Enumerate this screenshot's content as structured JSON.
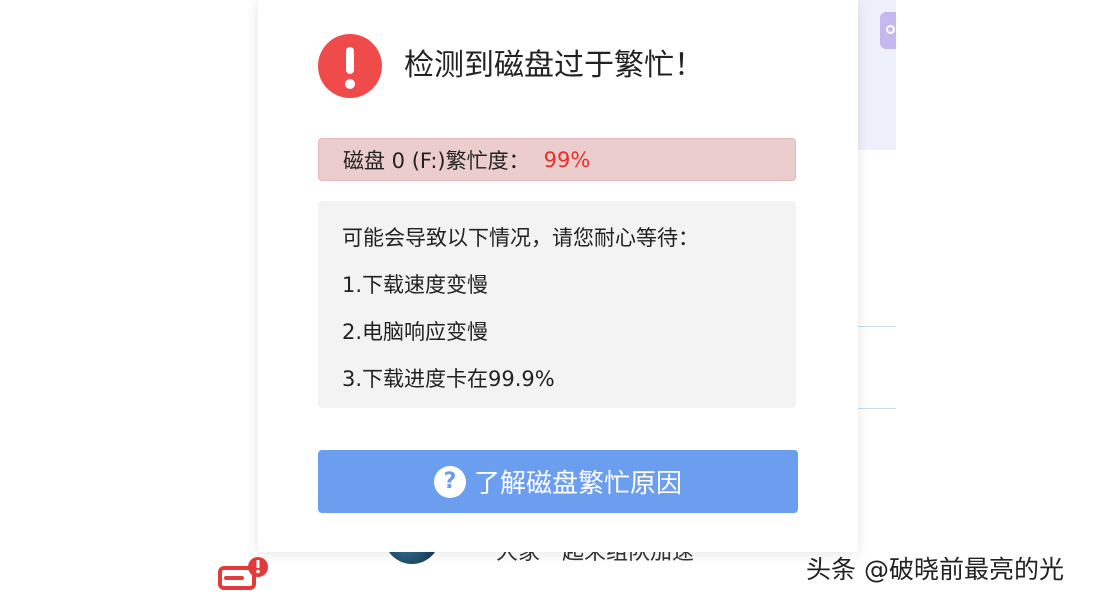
{
  "dialog": {
    "title": "检测到磁盘过于繁忙！",
    "busy": {
      "label": "磁盘 0 (F:)繁忙度：",
      "value": "99%"
    },
    "info": {
      "heading": "可能会导致以下情况，请您耐心等待：",
      "items": [
        "1.下载速度变慢",
        "2.电脑响应变慢",
        "3.下载进度卡在99.9%"
      ]
    },
    "button": {
      "label": "了解磁盘繁忙原因",
      "icon_glyph": "?"
    }
  },
  "background": {
    "partial_text": "大家一起来组队加速"
  },
  "watermark": "头条 @破晓前最亮的光",
  "colors": {
    "alert_red": "#ef4b4b",
    "busy_bar_bg": "#eccdcd",
    "busy_value": "#e8302a",
    "button_blue": "#6c9ef0",
    "info_bg": "#f3f3f3"
  },
  "icons": {
    "alert": "exclamation-circle-icon",
    "help": "question-circle-icon",
    "disk_warning": "disk-warning-icon"
  }
}
